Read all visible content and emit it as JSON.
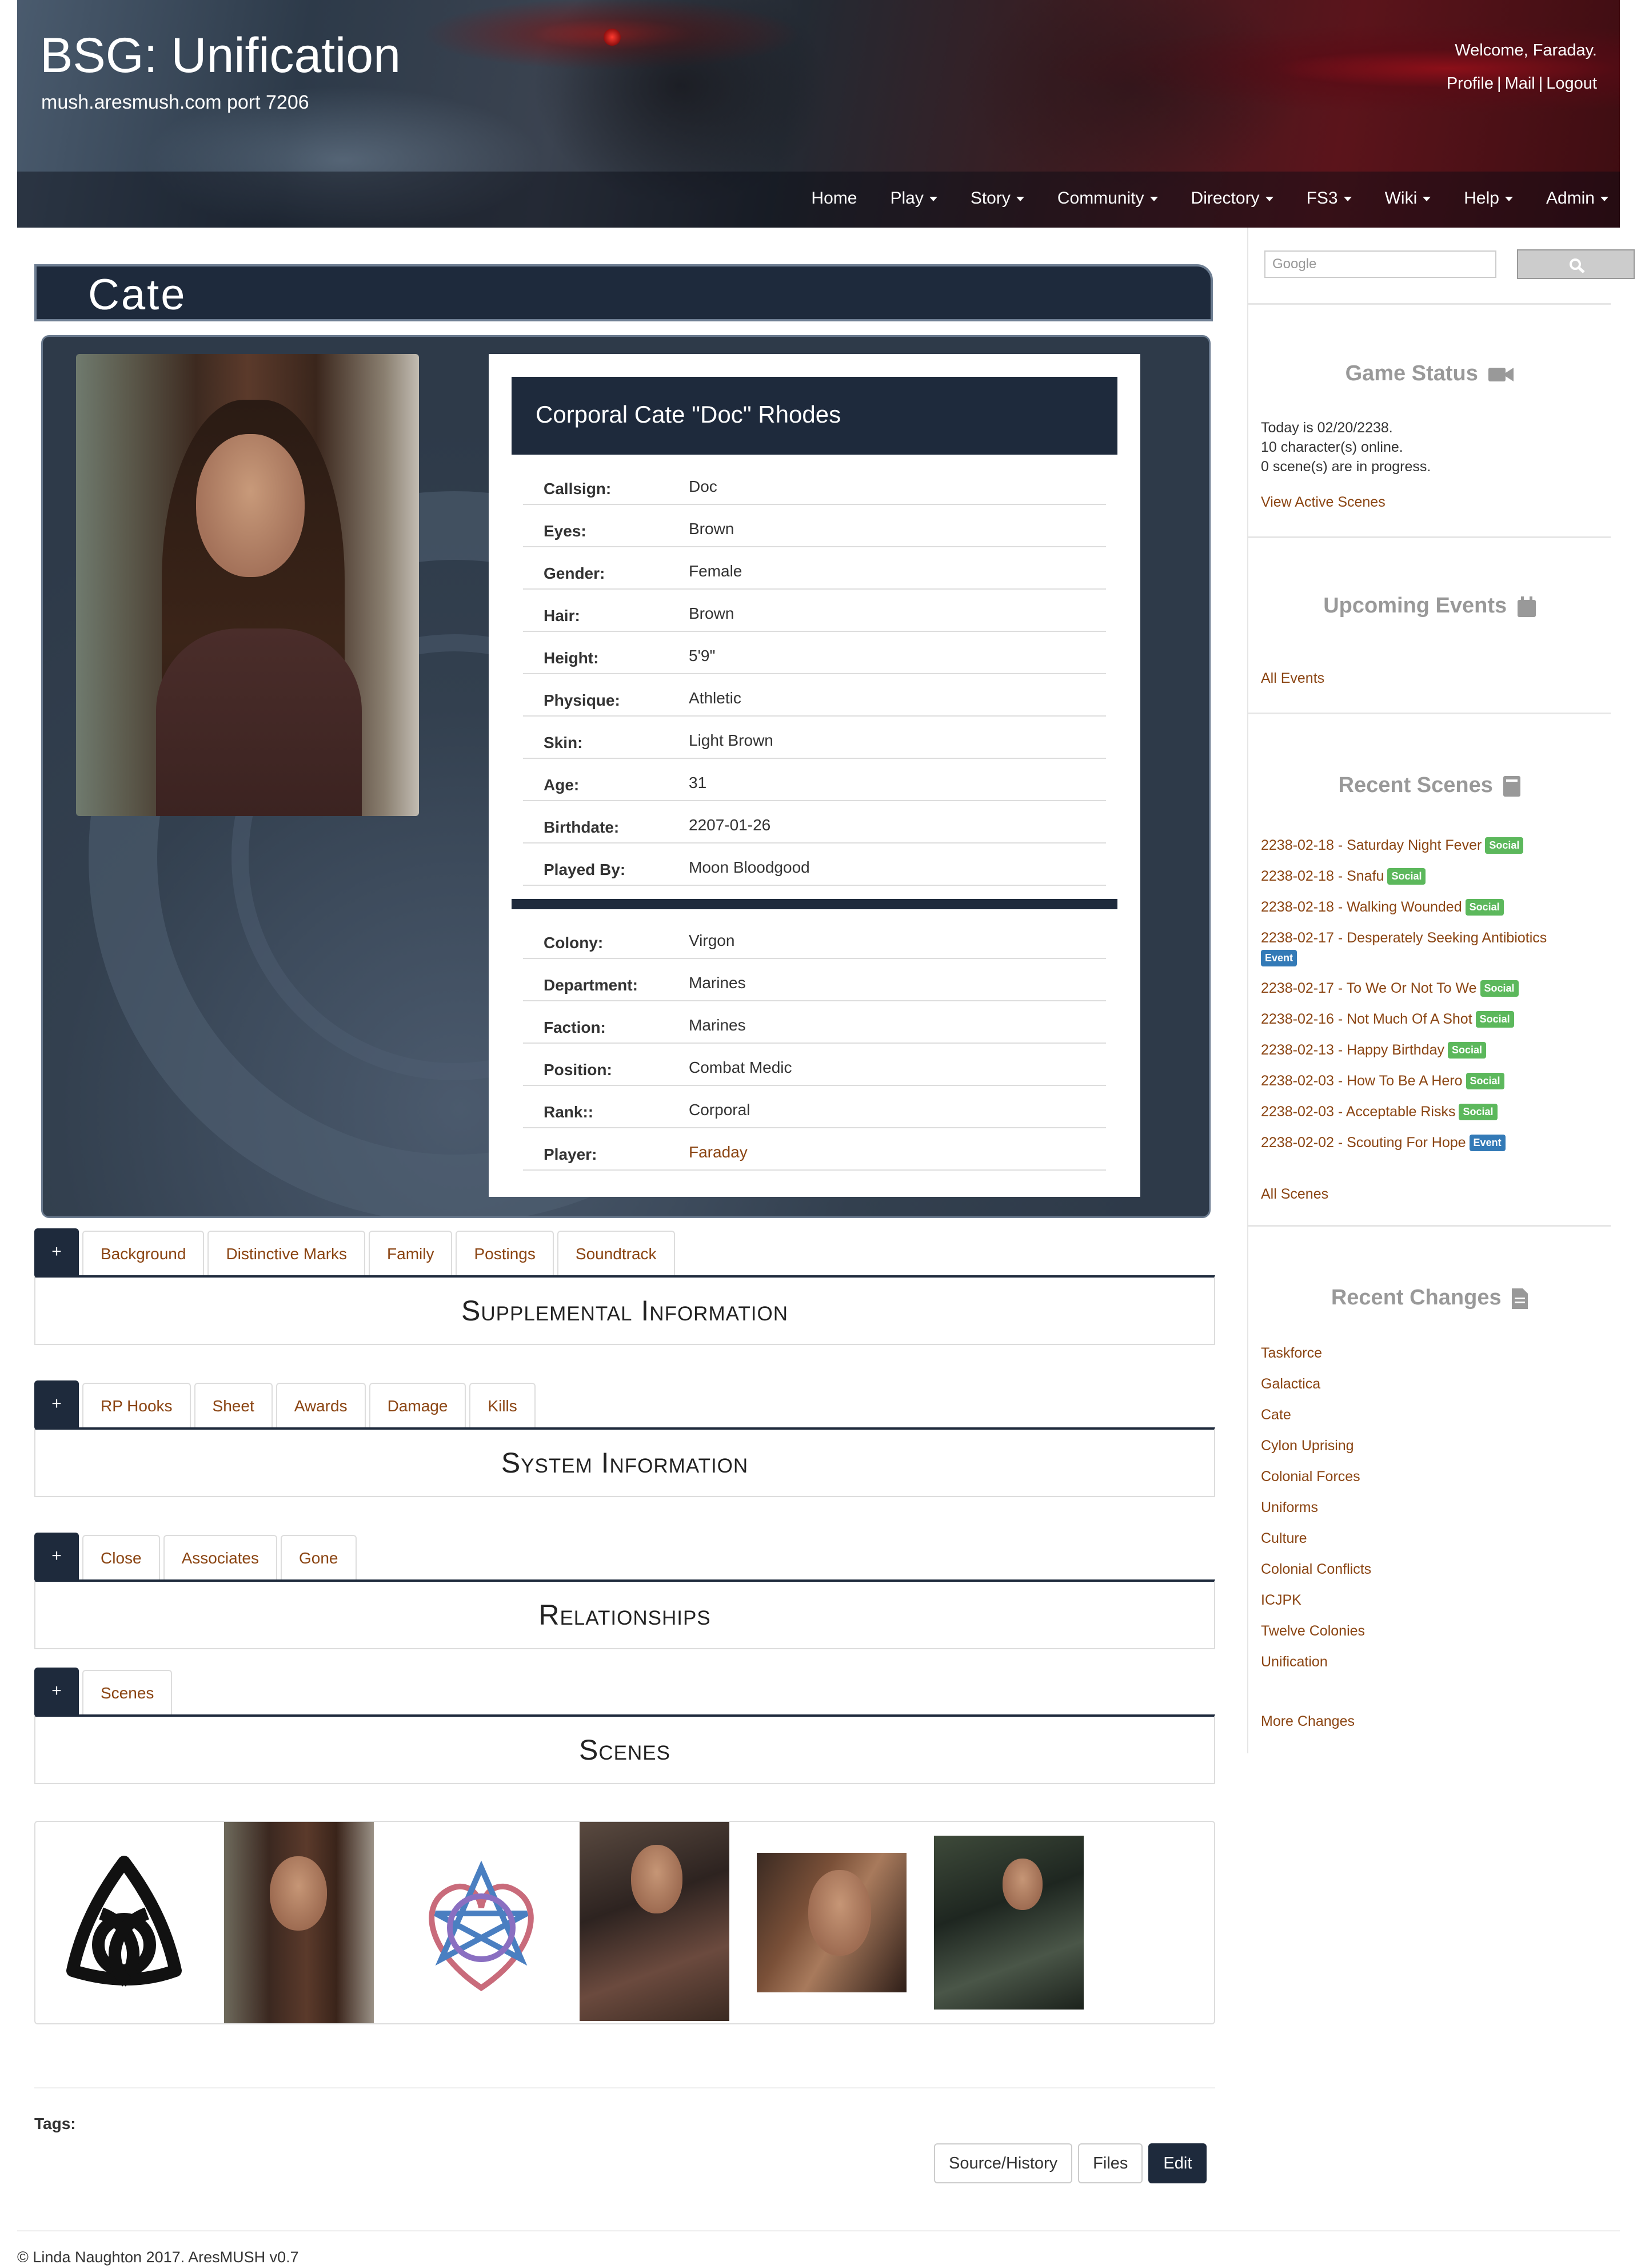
{
  "header": {
    "site_title": "BSG: Unification",
    "site_subtitle": "mush.aresmush.com port 7206",
    "welcome": "Welcome, Faraday.",
    "user_links": [
      "Profile",
      "Mail",
      "Logout"
    ],
    "nav": [
      "Home",
      "Play",
      "Story",
      "Community",
      "Directory",
      "FS3",
      "Wiki",
      "Help",
      "Admin"
    ]
  },
  "character": {
    "short_name": "Cate",
    "full_name": "Corporal Cate \"Doc\" Rhodes",
    "demographics": [
      {
        "label": "Callsign:",
        "value": "Doc"
      },
      {
        "label": "Eyes:",
        "value": "Brown"
      },
      {
        "label": "Gender:",
        "value": "Female"
      },
      {
        "label": "Hair:",
        "value": "Brown"
      },
      {
        "label": "Height:",
        "value": "5'9\""
      },
      {
        "label": "Physique:",
        "value": "Athletic"
      },
      {
        "label": "Skin:",
        "value": "Light Brown"
      },
      {
        "label": "Age:",
        "value": "31"
      },
      {
        "label": "Birthdate:",
        "value": "2207-01-26"
      },
      {
        "label": "Played By:",
        "value": "Moon Bloodgood"
      }
    ],
    "groups": [
      {
        "label": "Colony:",
        "value": "Virgon"
      },
      {
        "label": "Department:",
        "value": "Marines"
      },
      {
        "label": "Faction:",
        "value": "Marines"
      },
      {
        "label": "Position:",
        "value": "Combat Medic"
      },
      {
        "label": "Rank::",
        "value": "Corporal"
      },
      {
        "label": "Player:",
        "value": "Faraday"
      }
    ]
  },
  "sections": {
    "supplemental": {
      "plus": "+",
      "tabs": [
        "Background",
        "Distinctive Marks",
        "Family",
        "Postings",
        "Soundtrack"
      ],
      "title": "Supplemental Information"
    },
    "system": {
      "plus": "+",
      "tabs": [
        "RP Hooks",
        "Sheet",
        "Awards",
        "Damage",
        "Kills"
      ],
      "title": "System Information"
    },
    "relationships": {
      "plus": "+",
      "tabs": [
        "Close",
        "Associates",
        "Gone"
      ],
      "title": "Relationships"
    },
    "scenes": {
      "plus": "+",
      "tabs": [
        "Scenes"
      ],
      "title": "Scenes"
    }
  },
  "tags_label": "Tags:",
  "page_buttons": [
    "Source/History",
    "Files",
    "Edit"
  ],
  "footer": "© Linda Naughton 2017. AresMUSH v0.7",
  "sidebar": {
    "search_placeholder": "Google",
    "game_status": {
      "title": "Game Status",
      "lines": [
        "Today is 02/20/2238.",
        "10 character(s) online.",
        "0 scene(s) are in progress."
      ],
      "link": "View Active Scenes"
    },
    "upcoming_events": {
      "title": "Upcoming Events",
      "link": "All Events"
    },
    "recent_scenes": {
      "title": "Recent Scenes",
      "items": [
        {
          "text": "2238-02-18 - Saturday Night Fever",
          "badge": "Social"
        },
        {
          "text": "2238-02-18 - Snafu",
          "badge": "Social"
        },
        {
          "text": "2238-02-18 - Walking Wounded",
          "badge": "Social"
        },
        {
          "text": "2238-02-17 - Desperately Seeking Antibiotics",
          "badge": "Event"
        },
        {
          "text": "2238-02-17 - To We Or Not To We",
          "badge": "Social"
        },
        {
          "text": "2238-02-16 - Not Much Of A Shot",
          "badge": "Social"
        },
        {
          "text": "2238-02-13 - Happy Birthday",
          "badge": "Social"
        },
        {
          "text": "2238-02-03 - How To Be A Hero",
          "badge": "Social"
        },
        {
          "text": "2238-02-03 - Acceptable Risks",
          "badge": "Social"
        },
        {
          "text": "2238-02-02 - Scouting For Hope",
          "badge": "Event"
        }
      ],
      "link": "All Scenes"
    },
    "recent_changes": {
      "title": "Recent Changes",
      "items": [
        "Taskforce",
        "Galactica",
        "Cate",
        "Cylon Uprising",
        "Colonial Forces",
        "Uniforms",
        "Culture",
        "Colonial Conflicts",
        "ICJPK",
        "Twelve Colonies",
        "Unification"
      ],
      "link": "More Changes"
    }
  },
  "colors": {
    "accent_navy": "#1e2a3c",
    "link_brown": "#8b4513",
    "badge_social": "#5cb85c",
    "badge_event": "#337ab7"
  }
}
